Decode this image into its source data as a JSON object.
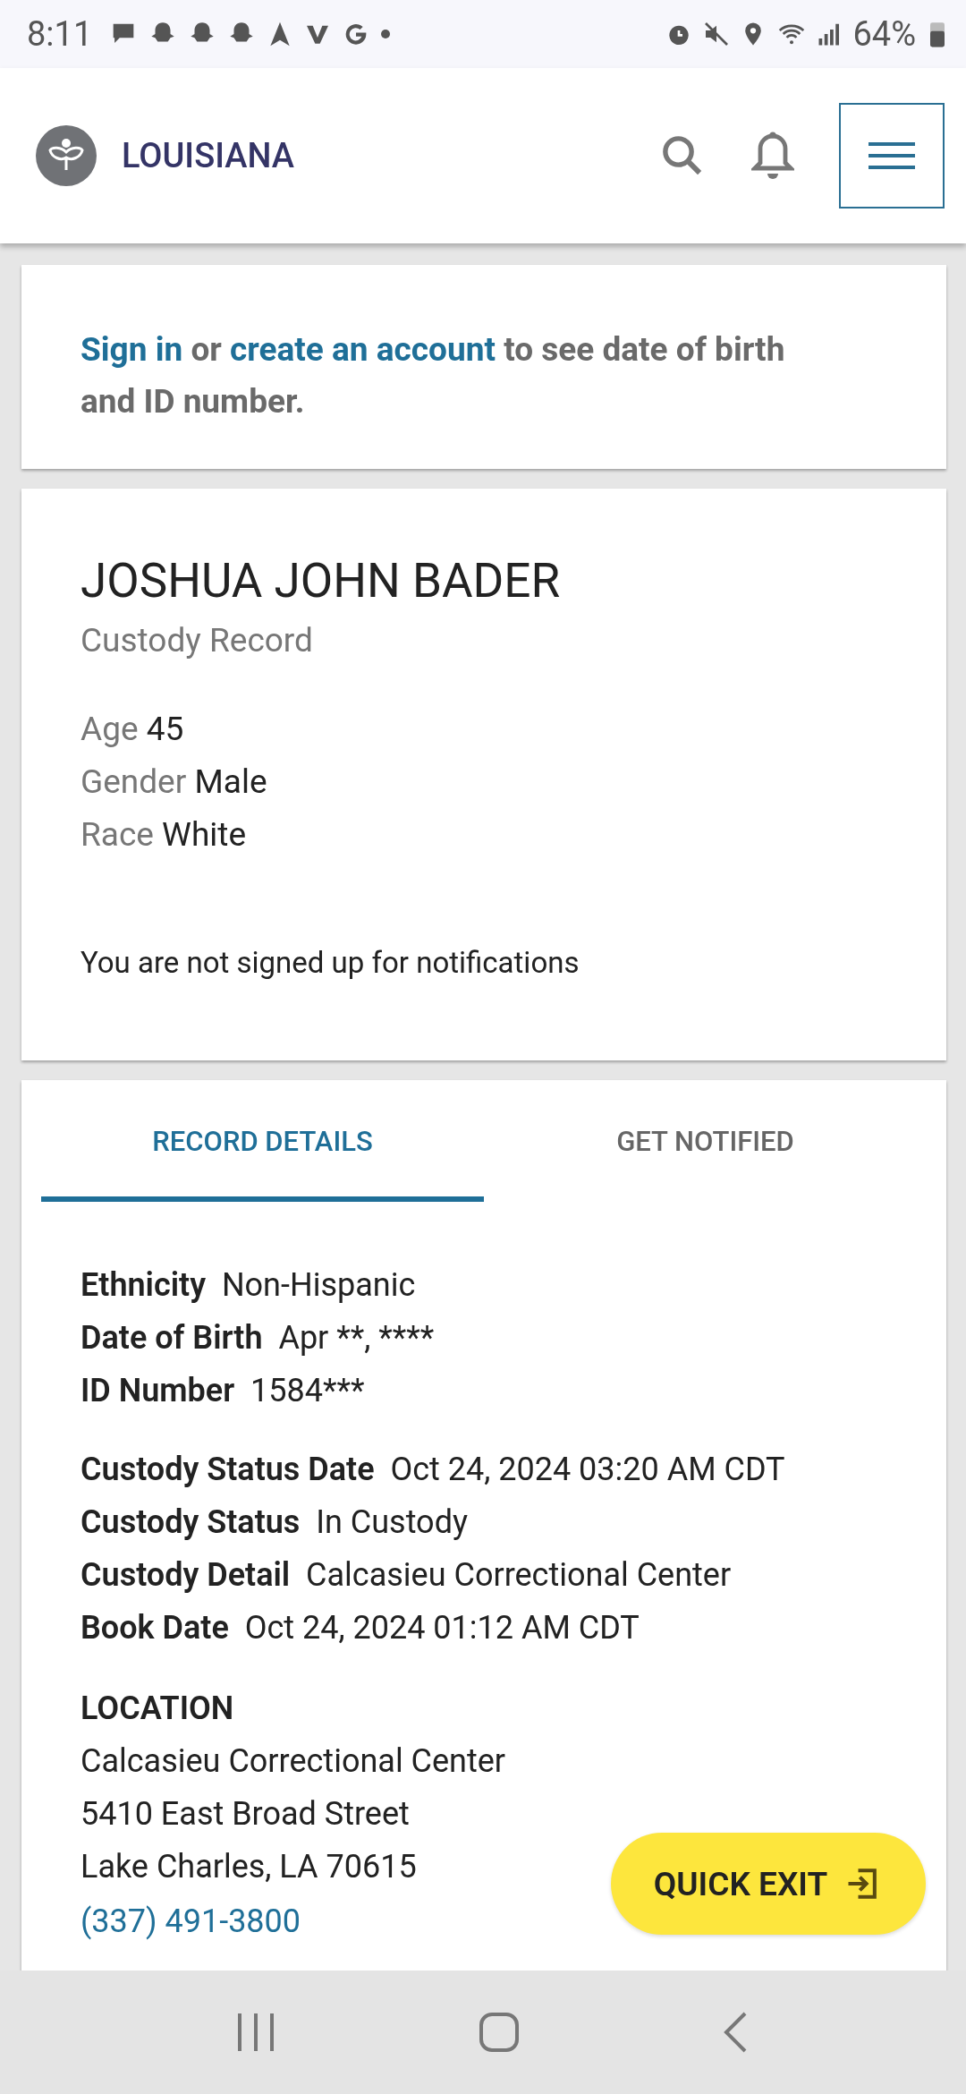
{
  "status_bar": {
    "time": "8:11",
    "battery": "64%"
  },
  "header": {
    "brand": "LOUISIANA"
  },
  "sign_in_notice": {
    "sign_in": "Sign in",
    "or": "or",
    "create": "create an account",
    "rest": "to see date of birth and ID number."
  },
  "person": {
    "name": "JOSHUA JOHN BADER",
    "subtitle": "Custody Record",
    "facts": [
      {
        "label": "Age",
        "value": "45"
      },
      {
        "label": "Gender",
        "value": "Male"
      },
      {
        "label": "Race",
        "value": "White"
      }
    ],
    "notification_status": "You are not signed up for notifications"
  },
  "tabs": [
    {
      "label": "RECORD DETAILS",
      "selected": true
    },
    {
      "label": "GET NOTIFIED",
      "selected": false
    }
  ],
  "details": [
    [
      {
        "label": "Ethnicity",
        "value": "Non-Hispanic"
      },
      {
        "label": "Date of Birth",
        "value": "Apr **, ****"
      },
      {
        "label": "ID Number",
        "value": "1584***"
      }
    ],
    [
      {
        "label": "Custody Status Date",
        "value": "Oct 24, 2024 03:20 AM CDT"
      },
      {
        "label": "Custody Status",
        "value": "In Custody"
      },
      {
        "label": "Custody Detail",
        "value": "Calcasieu Correctional Center"
      },
      {
        "label": "Book Date",
        "value": "Oct 24, 2024 01:12 AM CDT"
      }
    ]
  ],
  "location": {
    "heading": "LOCATION",
    "lines": [
      "Calcasieu Correctional Center",
      "5410 East Broad Street",
      "Lake Charles, LA 70615"
    ],
    "phone": "(337) 491-3800"
  },
  "quick_exit": {
    "label": "QUICK EXIT"
  }
}
